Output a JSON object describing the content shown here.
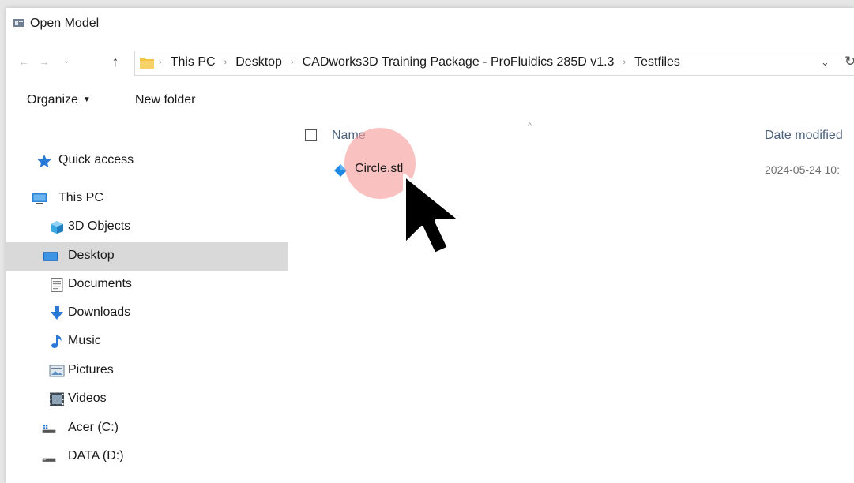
{
  "window": {
    "title": "Open Model"
  },
  "address_bar": {
    "crumbs": [
      "This PC",
      "Desktop",
      "CADworks3D Training Package - ProFluidics 285D v1.3",
      "Testfiles"
    ],
    "separator": "›",
    "dropdown_glyph": "⌄",
    "refresh_glyph": "↻"
  },
  "toolbar": {
    "organize_label": "Organize",
    "new_folder_label": "New folder"
  },
  "nav": {
    "items": [
      {
        "label": "Quick access",
        "icon": "star-icon"
      },
      {
        "label": "This PC",
        "icon": "computer-icon"
      },
      {
        "label": "3D Objects",
        "icon": "cube-icon"
      },
      {
        "label": "Desktop",
        "icon": "desktop-icon",
        "selected": true
      },
      {
        "label": "Documents",
        "icon": "document-icon"
      },
      {
        "label": "Downloads",
        "icon": "download-icon"
      },
      {
        "label": "Music",
        "icon": "music-icon"
      },
      {
        "label": "Pictures",
        "icon": "pictures-icon"
      },
      {
        "label": "Videos",
        "icon": "videos-icon"
      },
      {
        "label": "Acer (C:)",
        "icon": "drive-c-icon"
      },
      {
        "label": "DATA (D:)",
        "icon": "drive-d-icon"
      }
    ]
  },
  "columns": {
    "name": "Name",
    "date": "Date modified"
  },
  "files": [
    {
      "name": "Circle.stl",
      "date": "2024-05-24 10:"
    }
  ],
  "colors": {
    "selected_bg": "#d9d9d9",
    "accent_blue": "#1e88e5",
    "highlight": "#f8a0a0",
    "header_text": "#4c607a"
  }
}
